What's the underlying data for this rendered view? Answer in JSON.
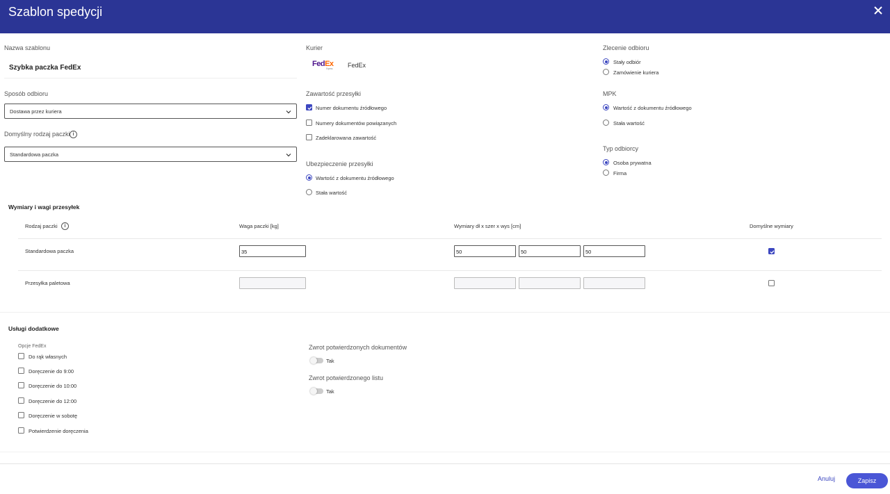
{
  "header": {
    "title": "Szablon spedycji"
  },
  "template_name": {
    "label": "Nazwa szablonu",
    "value": "Szybka paczka FedEx"
  },
  "courier": {
    "label": "Kurier",
    "name": "FedEx",
    "logo_text_a": "Fed",
    "logo_text_b": "Ex",
    "logo_sub": "Express"
  },
  "pickup_order": {
    "label": "Zlecenie odbioru",
    "options": [
      "Stały odbiór",
      "Zamówienie kuriera"
    ],
    "selected": 0
  },
  "pickup_method": {
    "label": "Sposób odbioru",
    "value": "Dostawa przez kuriera"
  },
  "default_package": {
    "label": "Domyślny rodzaj paczki",
    "value": "Standardowa paczka"
  },
  "contents": {
    "label": "Zawartość przesyłki",
    "options": [
      "Numer dokumentu źródłowego",
      "Numery dokumentów powiązanych",
      "Zadeklarowana zawartość"
    ],
    "checked": [
      true,
      false,
      false
    ]
  },
  "mpk": {
    "label": "MPK",
    "options": [
      "Wartość z dokumentu źródłowego",
      "Stała wartość"
    ],
    "selected": 0
  },
  "recipient_type": {
    "label": "Typ odbiorcy",
    "options": [
      "Osoba prywatna",
      "Firma"
    ],
    "selected": 0
  },
  "insurance": {
    "label": "Ubezpieczenie przesyłki",
    "options": [
      "Wartość z dokumentu źródłowego",
      "Stała wartość"
    ],
    "selected": 0
  },
  "dimensions": {
    "title": "Wymiary i wagi przesyłek",
    "columns": [
      "Rodzaj paczki",
      "Waga paczki [kg]",
      "Wymiary dł x szer x wys [cm]",
      "Domyślne wymiary"
    ],
    "rows": [
      {
        "name": "Standardowa paczka",
        "weight": "35",
        "length": "50",
        "width": "50",
        "height": "50",
        "default": true
      },
      {
        "name": "Przesyłka paletowa",
        "weight": "",
        "length": "",
        "width": "",
        "height": "",
        "default": false
      }
    ]
  },
  "services": {
    "title": "Usługi dodatkowe",
    "group_label": "Opcje FedEx",
    "options": [
      "Do rąk własnych",
      "Doręczenie do 9:00",
      "Doręczenie do 10:00",
      "Doręczenie do 12:00",
      "Doręczenie w sobotę",
      "Potwierdzenie doręczenia"
    ],
    "return_docs": {
      "label": "Zwrot potwierdzonych dokumentów",
      "toggle_label": "Tak",
      "on": false
    },
    "return_letter": {
      "label": "Zwrot potwierdzonego listu",
      "toggle_label": "Tak",
      "on": false
    }
  },
  "footer": {
    "cancel": "Anuluj",
    "save": "Zapisz"
  },
  "colors": {
    "header": "#2b3595",
    "accent": "#3c47c0",
    "save_button": "#4a56d6"
  },
  "icons": {
    "close": "close-icon",
    "chevron": "chevron-down-icon",
    "info": "info-icon"
  }
}
